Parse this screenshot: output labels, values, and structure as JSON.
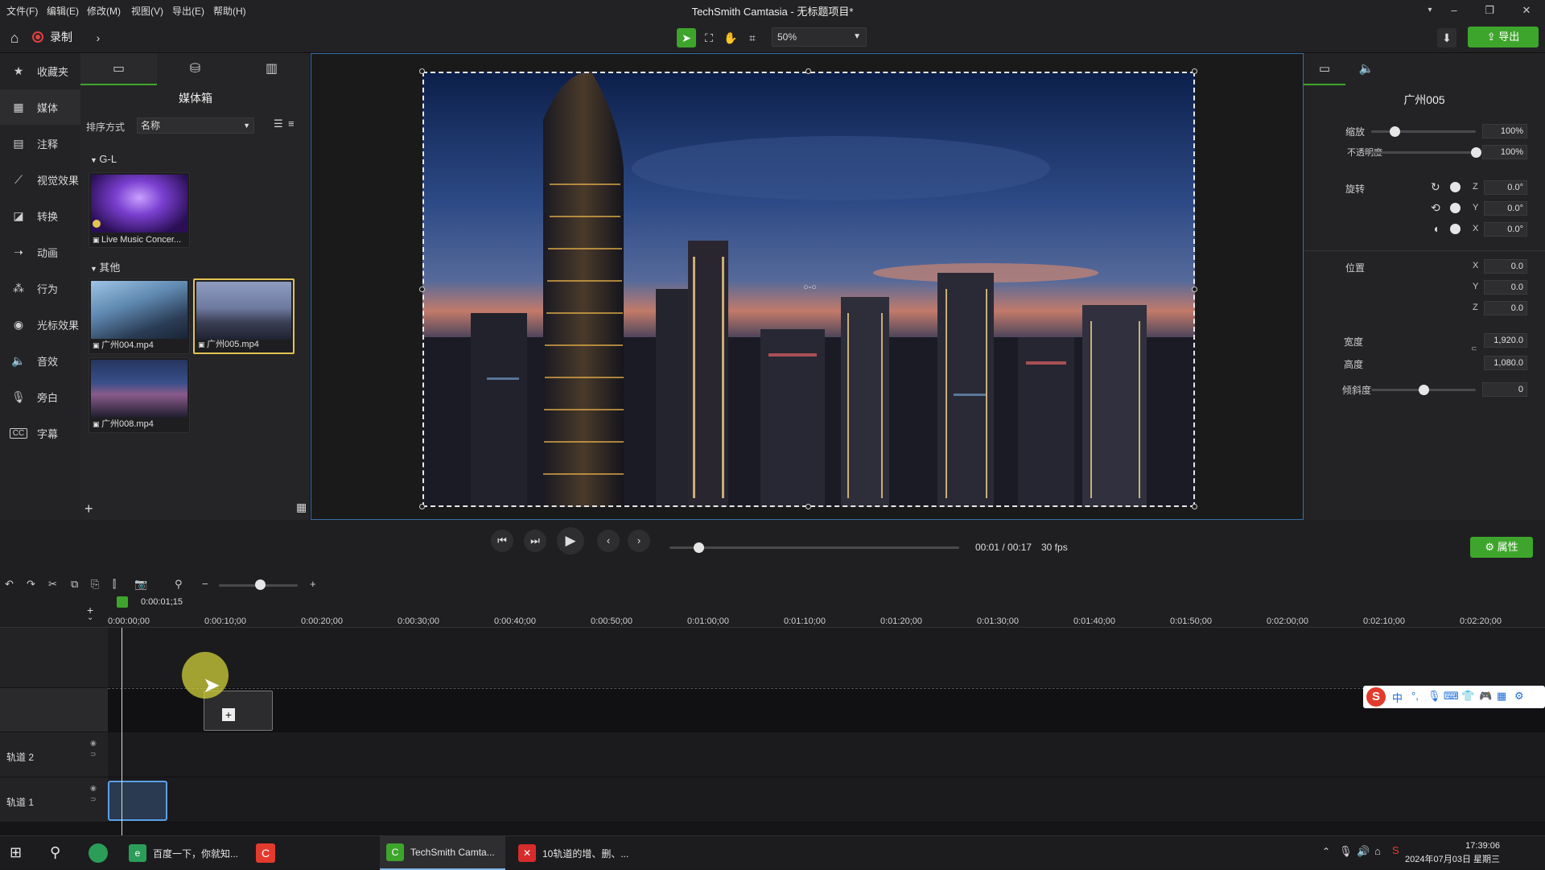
{
  "menubar": {
    "items": [
      "文件(F)",
      "编辑(E)",
      "修改(M)",
      "视图(V)",
      "导出(E)",
      "帮助(H)"
    ],
    "title": "TechSmith Camtasia - 无标题项目*"
  },
  "toolbar": {
    "record_label": "录制",
    "zoom_value": "50%",
    "export_label": "导出"
  },
  "nav": {
    "items": [
      {
        "label": "收藏夹",
        "icon": "star-icon"
      },
      {
        "label": "媒体",
        "icon": "media-icon"
      },
      {
        "label": "注释",
        "icon": "annotation-icon"
      },
      {
        "label": "视觉效果",
        "icon": "visual-effects-icon"
      },
      {
        "label": "转换",
        "icon": "transition-icon"
      },
      {
        "label": "动画",
        "icon": "animation-icon"
      },
      {
        "label": "行为",
        "icon": "behavior-icon"
      },
      {
        "label": "光标效果",
        "icon": "cursor-effects-icon"
      },
      {
        "label": "音效",
        "icon": "audio-effects-icon"
      },
      {
        "label": "旁白",
        "icon": "microphone-icon"
      },
      {
        "label": "字幕",
        "icon": "captions-icon"
      }
    ]
  },
  "bin": {
    "title": "媒体箱",
    "sort_label": "排序方式",
    "sort_value": "名称",
    "groups": [
      {
        "name": "G-L",
        "items": [
          "Live Music Concer..."
        ]
      },
      {
        "name": "其他",
        "items": [
          "广州004.mp4",
          "广州005.mp4",
          "广州008.mp4"
        ]
      }
    ]
  },
  "props": {
    "title": "广州005",
    "scale_label": "缩放",
    "scale_value": "100%",
    "scale_level": 0.22,
    "opacity_label": "不透明度",
    "opacity_value": "100%",
    "opacity_level": 1.0,
    "rotation_label": "旋转",
    "rotation": {
      "z": "0.0°",
      "y": "0.0°",
      "x": "0.0°"
    },
    "axis": {
      "x": "X",
      "y": "Y",
      "z": "Z"
    },
    "position_label": "位置",
    "position": {
      "x": "0.0",
      "y": "0.0",
      "z": "0.0"
    },
    "width_label": "宽度",
    "width_value": "1,920.0",
    "height_label": "高度",
    "height_value": "1,080.0",
    "skew_label": "倾斜度",
    "skew_value": "0",
    "skew_level": 0.5
  },
  "transport": {
    "time": "00:01 / 00:17",
    "fps": "30 fps",
    "progress": 0.1,
    "properties_label": "属性"
  },
  "timeline": {
    "playhead_time": "0:00:01;15",
    "ticks": [
      "0:00:00;00",
      "0:00:10;00",
      "0:00:20;00",
      "0:00:30;00",
      "0:00:40;00",
      "0:00:50;00",
      "0:01:00;00",
      "0:01:10;00",
      "0:01:20;00",
      "0:01:30;00",
      "0:01:40;00",
      "0:01:50;00",
      "0:02:00;00",
      "0:02:10;00",
      "0:02:20;00"
    ],
    "tracks": [
      "轨道 2",
      "轨道 1"
    ]
  },
  "ime": {
    "lang": "中"
  },
  "taskbar": {
    "apps": [
      "百度一下，你就知...",
      "TechSmith Camta...",
      "10轨道的增、删、..."
    ],
    "time": "17:39:06",
    "date": "2024年07月03日 星期三"
  },
  "colors": {
    "accent": "#3ea52c",
    "selection": "#e3c352",
    "focus": "#3a6ea5"
  }
}
